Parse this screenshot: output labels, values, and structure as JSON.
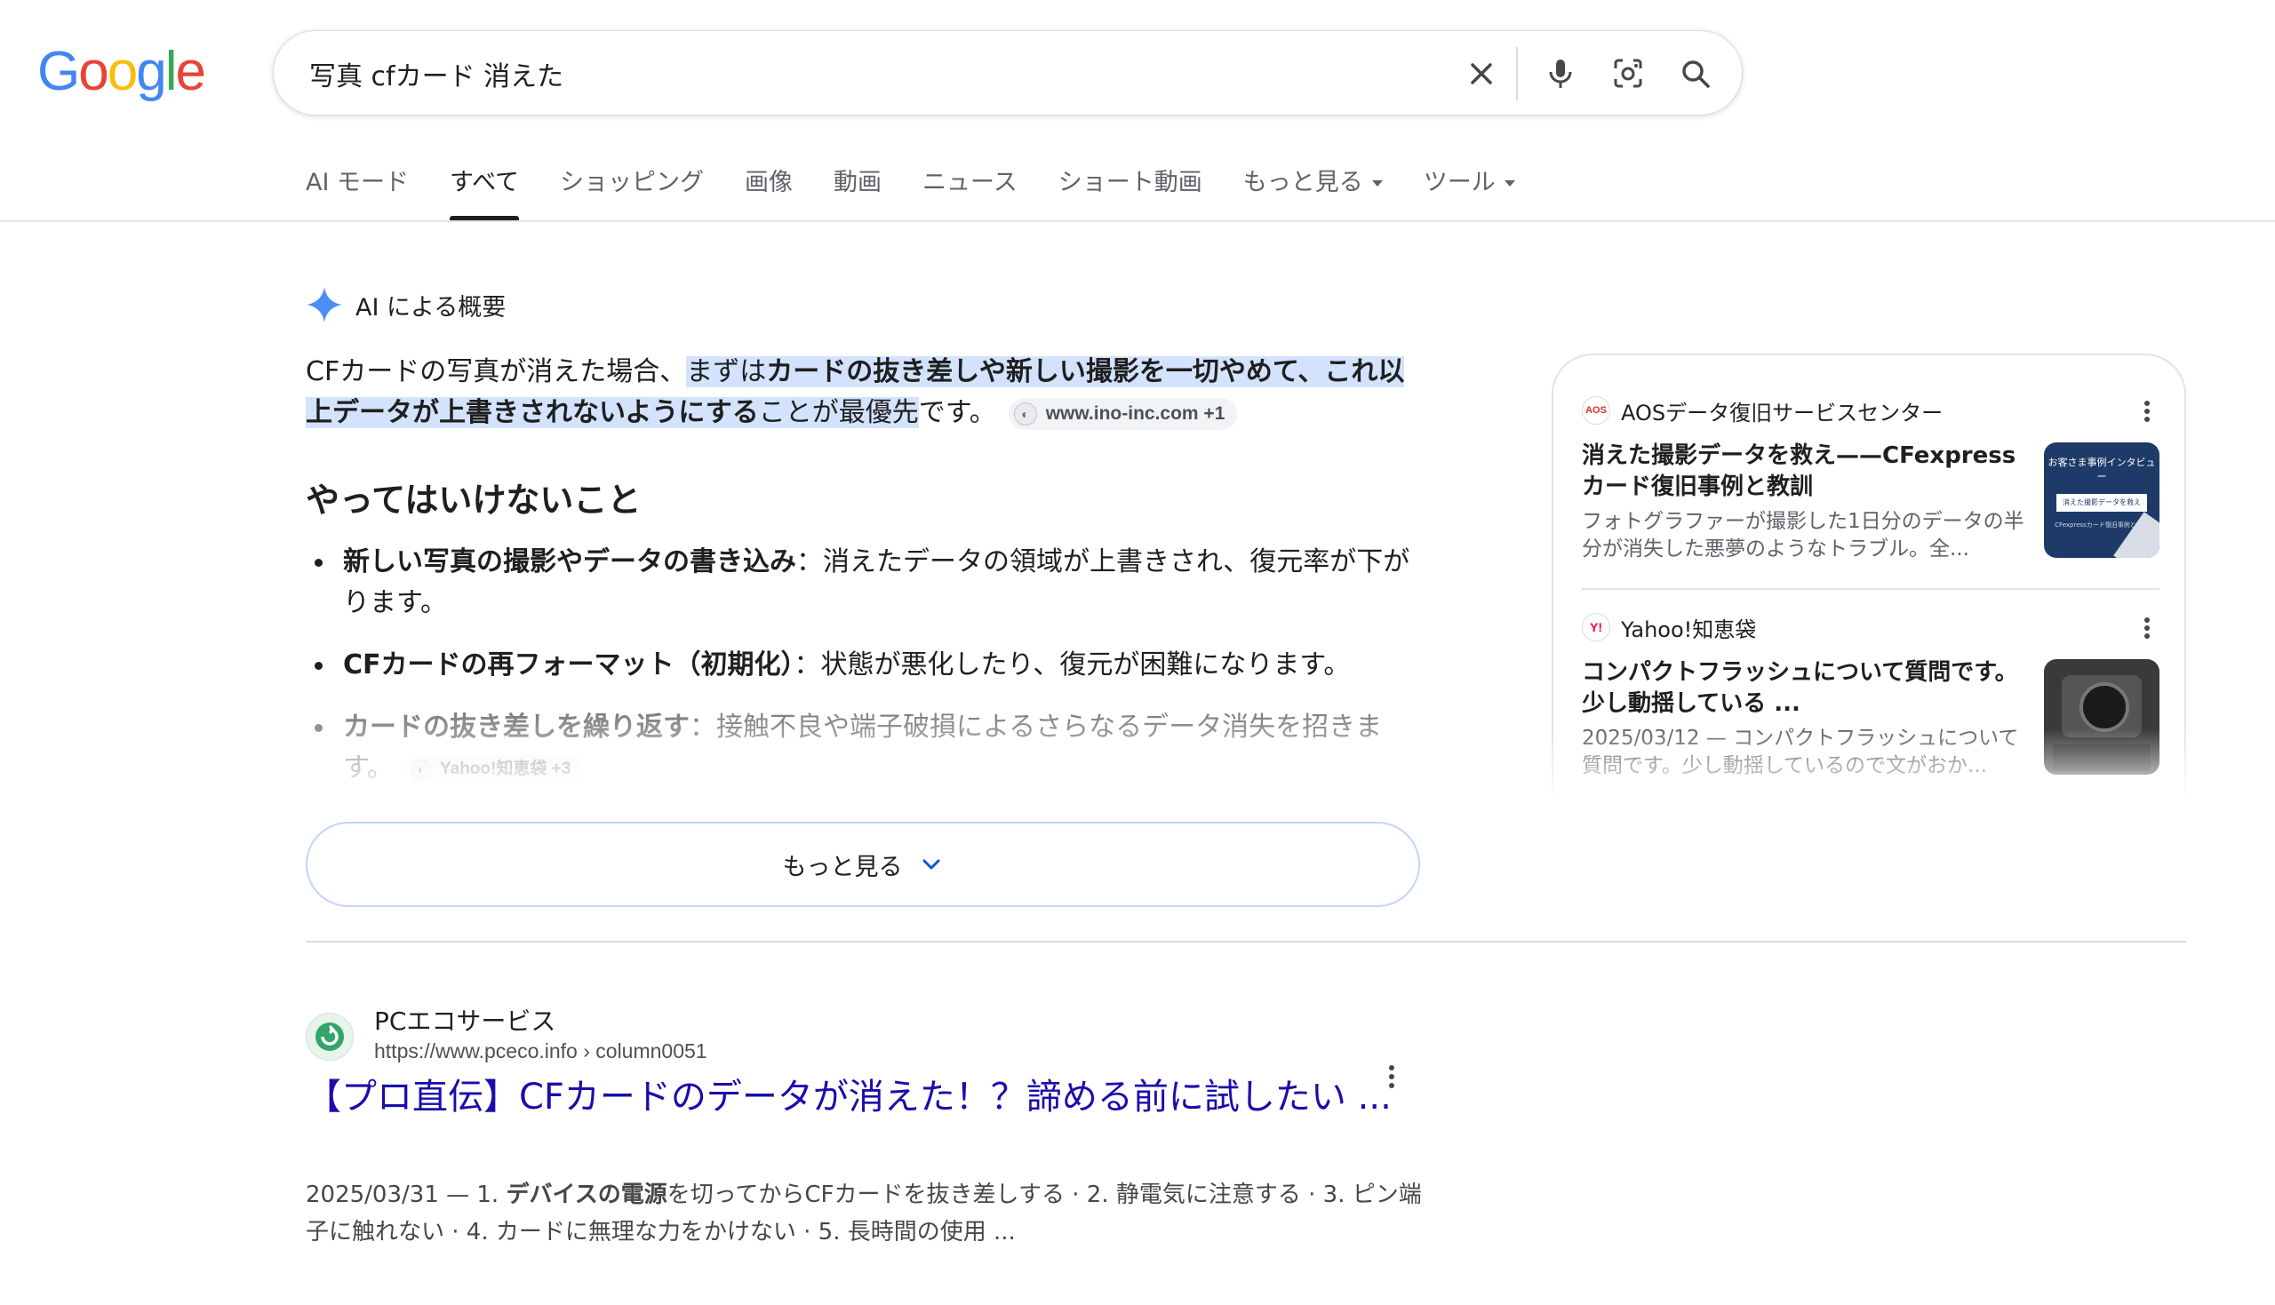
{
  "header": {
    "logo_letters": [
      "G",
      "o",
      "o",
      "g",
      "l",
      "e"
    ],
    "search_query": "写真 cfカード 消えた"
  },
  "tabs": [
    {
      "label": "AI モード"
    },
    {
      "label": "すべて"
    },
    {
      "label": "ショッピング"
    },
    {
      "label": "画像"
    },
    {
      "label": "動画"
    },
    {
      "label": "ニュース"
    },
    {
      "label": "ショート動画"
    },
    {
      "label": "もっと見る"
    },
    {
      "label": "ツール"
    }
  ],
  "ai_overview": {
    "label": "AI による概要",
    "intro_pre": "CFカードの写真が消えた場合、",
    "intro_hl_1": "まずは",
    "intro_hl_bold": "カードの抜き差しや新しい撮影を一切やめて、これ以上データが上書きされないようにする",
    "intro_hl_2": "ことが最優先",
    "intro_post": "です。",
    "intro_citation": "www.ino-inc.com +1",
    "heading": "やってはいけないこと",
    "bullets": [
      {
        "bold": "新しい写真の撮影やデータの書き込み",
        "text": "：消えたデータの領域が上書きされ、復元率が下がります。"
      },
      {
        "bold": "CFカードの再フォーマット（初期化）",
        "text": "：状態が悪化したり、復元が困難になります。"
      },
      {
        "bold": "カードの抜き差しを繰り返す",
        "text": "：接触不良や端子破損によるさらなるデータ消失を招きます。",
        "citation": "Yahoo!知恵袋 +3"
      }
    ],
    "show_more_label": "もっと見る"
  },
  "side_cards": [
    {
      "source": "AOSデータ復旧サービスセンター",
      "favicon_text": "AOS",
      "title": "消えた撮影データを救え——CFexpressカード復旧事例と教訓",
      "snippet": "フォトグラファーが撮影した1日分のデータの半分が消失した悪夢のようなトラブル。全...",
      "thumb_title": "お客さま事例インタビュー",
      "thumb_sub": "消えた撮影データを救え",
      "thumb_caption": "CFexpressカード復旧事例と教訓"
    },
    {
      "source": "Yahoo!知恵袋",
      "favicon_text": "Y!",
      "title": "コンパクトフラッシュについて質問です。少し動揺している ...",
      "snippet": "2025/03/12 — コンパクトフラッシュについて質問です。少し動揺しているので文がおか..."
    }
  ],
  "result": {
    "site_name": "PCエコサービス",
    "url": "https://www.pceco.info › column0051",
    "title": "【プロ直伝】CFカードのデータが消えた！？諦める前に試したい ...",
    "snippet_date": "2025/03/31 — 1. ",
    "snippet_bold": "デバイスの電源",
    "snippet_rest": "を切ってからCFカードを抜き差しする · 2. 静電気に注意する · 3. ピン端子に触れない · 4. カードに無理な力をかけない · 5. 長時間の使用 ..."
  },
  "colors": {
    "link": "#1a0dab",
    "highlight": "#d3e3fd",
    "google_blue": "#4285f4",
    "google_red": "#ea4335",
    "google_yellow": "#fbbc05",
    "google_green": "#34a853"
  }
}
